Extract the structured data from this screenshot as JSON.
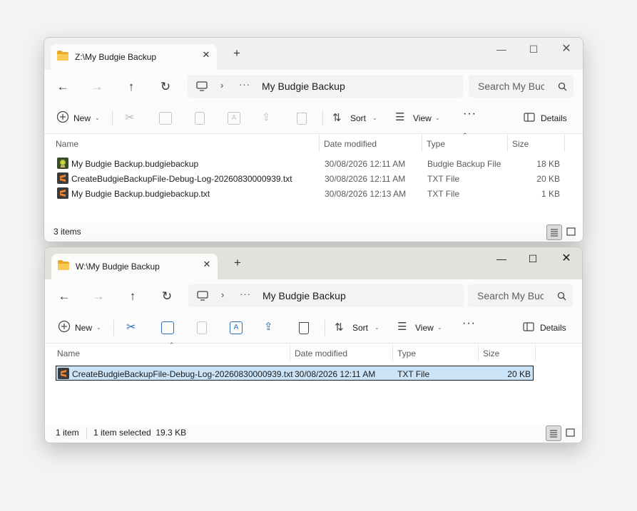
{
  "colors": {
    "folder": "#f5c54c",
    "selection": "#cce4f7",
    "sublime": "#f2822c"
  },
  "windows": [
    {
      "tab_title": "Z:\\My Budgie Backup",
      "address": "My Budgie Backup",
      "search_placeholder": "Search My Buc",
      "toolbar": {
        "new": "New",
        "sort": "Sort",
        "view": "View",
        "details": "Details"
      },
      "columns": {
        "name": "Name",
        "date": "Date modified",
        "type": "Type",
        "size": "Size"
      },
      "files": [
        {
          "name": "My Budgie Backup.budgiebackup",
          "date": "30/08/2026 12:11 AM",
          "type": "Budgie Backup File",
          "size": "18 KB",
          "icon": "budgie-backup-icon"
        },
        {
          "name": "CreateBudgieBackupFile-Debug-Log-20260830000939.txt",
          "date": "30/08/2026 12:11 AM",
          "type": "TXT File",
          "size": "20 KB",
          "icon": "sublime-text-icon"
        },
        {
          "name": "My Budgie Backup.budgiebackup.txt",
          "date": "30/08/2026 12:13 AM",
          "type": "TXT File",
          "size": "1 KB",
          "icon": "sublime-text-icon"
        }
      ],
      "status": {
        "count": "3 items"
      }
    },
    {
      "tab_title": "W:\\My Budgie Backup",
      "address": "My Budgie Backup",
      "search_placeholder": "Search My Buc",
      "toolbar": {
        "new": "New",
        "sort": "Sort",
        "view": "View",
        "details": "Details"
      },
      "columns": {
        "name": "Name",
        "date": "Date modified",
        "type": "Type",
        "size": "Size"
      },
      "files": [
        {
          "name": "CreateBudgieBackupFile-Debug-Log-20260830000939.txt",
          "date": "30/08/2026 12:11 AM",
          "type": "TXT File",
          "size": "20 KB",
          "icon": "sublime-text-icon",
          "selected": true
        }
      ],
      "status": {
        "count": "1 item",
        "selected": "1 item selected  19.3 KB"
      }
    }
  ]
}
